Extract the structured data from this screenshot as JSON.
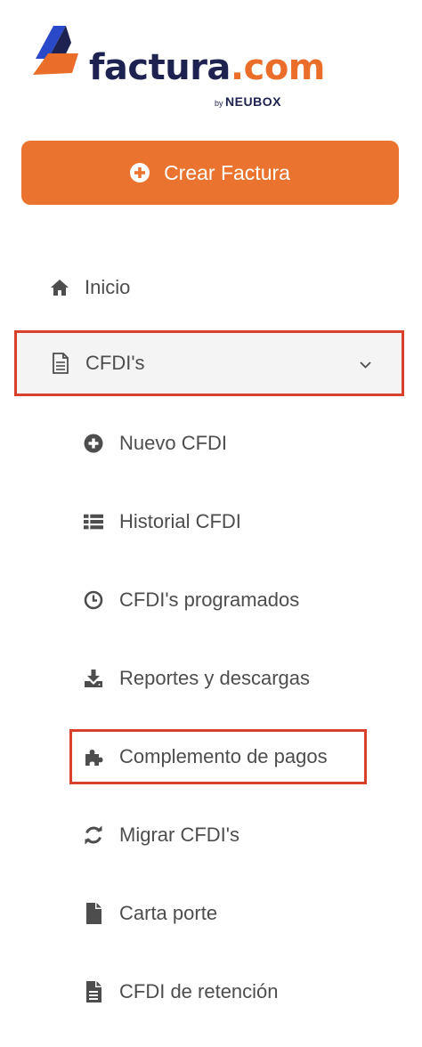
{
  "brand": {
    "name": "factura",
    "tld": ".com",
    "by_prefix": "by",
    "by_name": "NEUBOX",
    "colors": {
      "navy": "#1e2251",
      "orange": "#ea6e2a",
      "blue": "#2a49c8"
    }
  },
  "create_button": {
    "label": "Crear Factura",
    "icon": "plus-circle-icon",
    "color": "#ea742f"
  },
  "nav": {
    "inicio": {
      "label": "Inicio",
      "icon": "home-icon"
    },
    "cfdis": {
      "label": "CFDI's",
      "icon": "document-icon",
      "expanded": true
    },
    "sub": [
      {
        "label": "Nuevo CFDI",
        "icon": "plus-circle-icon"
      },
      {
        "label": "Historial CFDI",
        "icon": "list-icon"
      },
      {
        "label": "CFDI's programados",
        "icon": "clock-icon"
      },
      {
        "label": "Reportes y descargas",
        "icon": "download-icon"
      },
      {
        "label": "Complemento de pagos",
        "icon": "puzzle-icon"
      },
      {
        "label": "Migrar CFDI's",
        "icon": "refresh-icon"
      },
      {
        "label": "Carta porte",
        "icon": "file-icon"
      },
      {
        "label": "CFDI de retención",
        "icon": "file-text-icon"
      }
    ]
  },
  "highlight_color": "#d9402b"
}
